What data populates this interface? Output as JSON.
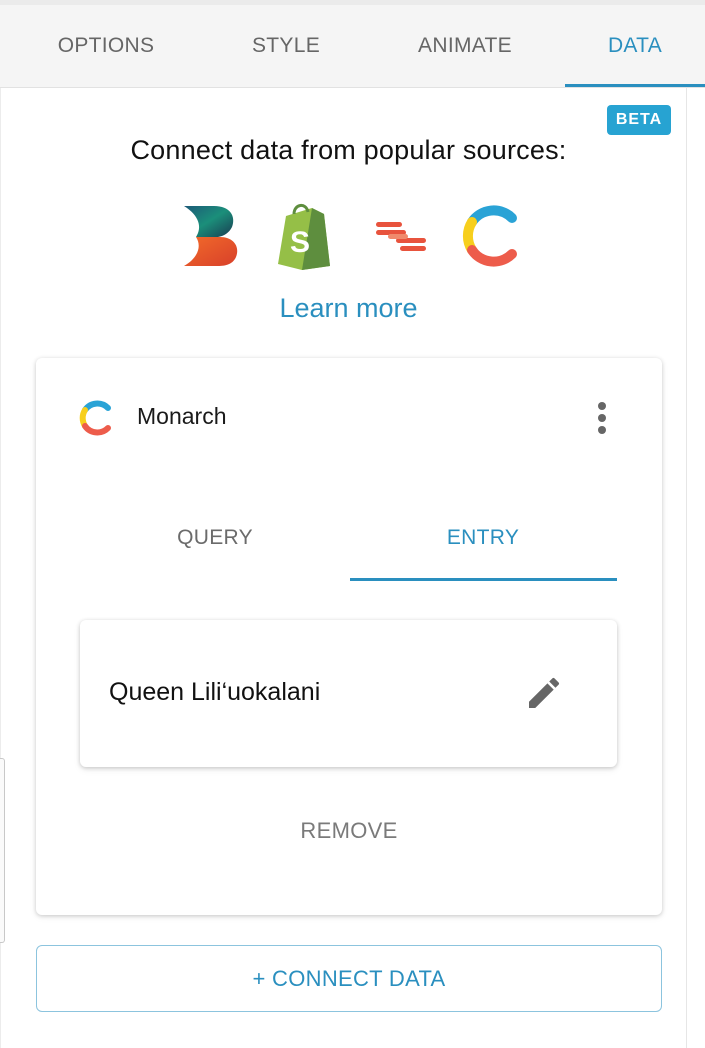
{
  "tabs": {
    "options": "OPTIONS",
    "style": "STYLE",
    "animate": "ANIMATE",
    "data": "DATA",
    "active": "DATA"
  },
  "badge": "BETA",
  "headline": "Connect data from popular sources:",
  "sources": [
    {
      "name": "b-logo-icon"
    },
    {
      "name": "shopify-icon"
    },
    {
      "name": "stripes-logo-icon"
    },
    {
      "name": "contentful-icon"
    }
  ],
  "learn_more": "Learn more",
  "source_card": {
    "icon": "contentful-icon",
    "title": "Monarch",
    "menu_icon": "more-vert-icon",
    "tabs": {
      "query": "QUERY",
      "entry": "ENTRY",
      "active": "ENTRY"
    },
    "entry": {
      "name": "Queen Lili‘uokalani",
      "edit_icon": "pencil-icon"
    },
    "remove": "REMOVE"
  },
  "connect_button": "+ CONNECT DATA",
  "colors": {
    "accent": "#2a8fbf",
    "badge": "#27a3d2"
  }
}
